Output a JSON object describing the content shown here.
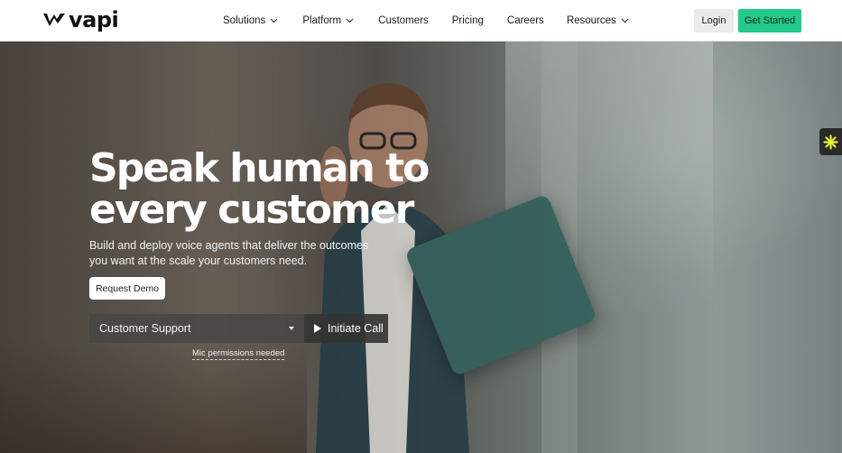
{
  "brand": {
    "name": "vapi",
    "accent": "#22c98b"
  },
  "nav": {
    "items": [
      {
        "label": "Solutions",
        "dropdown": true
      },
      {
        "label": "Platform",
        "dropdown": true
      },
      {
        "label": "Customers",
        "dropdown": false
      },
      {
        "label": "Pricing",
        "dropdown": false
      },
      {
        "label": "Careers",
        "dropdown": false
      },
      {
        "label": "Resources",
        "dropdown": true
      }
    ],
    "login_label": "Login",
    "cta_label": "Get Started"
  },
  "hero": {
    "headline": "Speak human to every customer",
    "subline": "Build and deploy voice agents that deliver the outcomes you want at the scale your customers need.",
    "demo_label": "Request Demo",
    "agent_select_value": "Customer Support",
    "call_label": "Initiate Call",
    "mic_note": "Mic permissions needed"
  },
  "icons": {
    "logo": "vapi-logo-icon",
    "chevron": "chevron-down-icon",
    "caret": "caret-down-icon",
    "play": "play-icon",
    "widget": "asterisk-icon"
  }
}
